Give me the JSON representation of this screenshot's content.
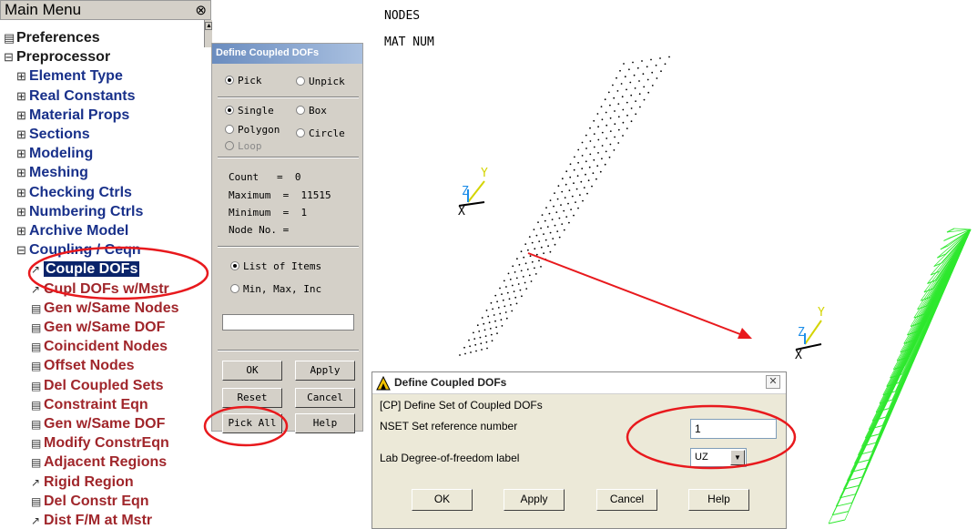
{
  "main_menu": {
    "title": "Main Menu",
    "collapse_glyph": "⊗",
    "items": [
      {
        "glyph": "▤",
        "label": "Preferences",
        "level": 0
      },
      {
        "glyph": "⊟",
        "label": "Preprocessor",
        "level": 0
      },
      {
        "glyph": "⊞",
        "label": "Element Type",
        "level": 1
      },
      {
        "glyph": "⊞",
        "label": "Real Constants",
        "level": 1
      },
      {
        "glyph": "⊞",
        "label": "Material Props",
        "level": 1
      },
      {
        "glyph": "⊞",
        "label": "Sections",
        "level": 1
      },
      {
        "glyph": "⊞",
        "label": "Modeling",
        "level": 1
      },
      {
        "glyph": "⊞",
        "label": "Meshing",
        "level": 1
      },
      {
        "glyph": "⊞",
        "label": "Checking Ctrls",
        "level": 1
      },
      {
        "glyph": "⊞",
        "label": "Numbering Ctrls",
        "level": 1
      },
      {
        "glyph": "⊞",
        "label": "Archive Model",
        "level": 1
      },
      {
        "glyph": "⊟",
        "label": "Coupling / Ceqn",
        "level": 1
      },
      {
        "glyph": "↗",
        "label": "Couple DOFs",
        "level": 2,
        "selected": true
      },
      {
        "glyph": "↗",
        "label": "Cupl DOFs w/Mstr",
        "level": 2
      },
      {
        "glyph": "▤",
        "label": "Gen w/Same Nodes",
        "level": 2
      },
      {
        "glyph": "▤",
        "label": "Gen w/Same DOF",
        "level": 2
      },
      {
        "glyph": "▤",
        "label": "Coincident Nodes",
        "level": 2
      },
      {
        "glyph": "▤",
        "label": "Offset Nodes",
        "level": 2
      },
      {
        "glyph": "▤",
        "label": "Del Coupled Sets",
        "level": 2
      },
      {
        "glyph": "▤",
        "label": "Constraint Eqn",
        "level": 2
      },
      {
        "glyph": "▤",
        "label": "Gen w/Same DOF",
        "level": 2
      },
      {
        "glyph": "▤",
        "label": "Modify ConstrEqn",
        "level": 2
      },
      {
        "glyph": "▤",
        "label": "Adjacent Regions",
        "level": 2
      },
      {
        "glyph": "↗",
        "label": "Rigid Region",
        "level": 2
      },
      {
        "glyph": "▤",
        "label": "Del Constr Eqn",
        "level": 2
      },
      {
        "glyph": "↗",
        "label": "Dist F/M at Mstr",
        "level": 2
      }
    ]
  },
  "pick_dialog": {
    "title": "Define Coupled DOFs",
    "pick": "Pick",
    "unpick": "Unpick",
    "single": "Single",
    "box": "Box",
    "polygon": "Polygon",
    "circle": "Circle",
    "loop": "Loop",
    "count_label": "Count",
    "count_value": "0",
    "maximum_label": "Maximum",
    "maximum_value": "11515",
    "minimum_label": "Minimum",
    "minimum_value": "1",
    "node_no_label": "Node No. =",
    "list_of_items": "List of Items",
    "min_max_inc": "Min, Max, Inc",
    "buttons": {
      "ok": "OK",
      "apply": "Apply",
      "reset": "Reset",
      "cancel": "Cancel",
      "pick_all": "Pick All",
      "help": "Help"
    }
  },
  "graphics": {
    "line1": "NODES",
    "line2": "MAT  NUM",
    "axis_x": "X",
    "axis_y": "Y",
    "axis_z": "Z"
  },
  "cp_dialog": {
    "title": "Define Coupled DOFs",
    "header": "[CP]  Define Set of Coupled DOFs",
    "nset_label": "NSET  Set reference number",
    "nset_value": "1",
    "lab_label": "Lab  Degree-of-freedom label",
    "lab_value": "UZ",
    "buttons": {
      "ok": "OK",
      "apply": "Apply",
      "cancel": "Cancel",
      "help": "Help"
    }
  },
  "colors": {
    "annotation": "#e8191d",
    "mesh": "#2ee82e",
    "axis_y": "#d4d400",
    "axis_z": "#1e8ee8",
    "menu_level1": "#18308a",
    "menu_level2": "#a0262b"
  }
}
